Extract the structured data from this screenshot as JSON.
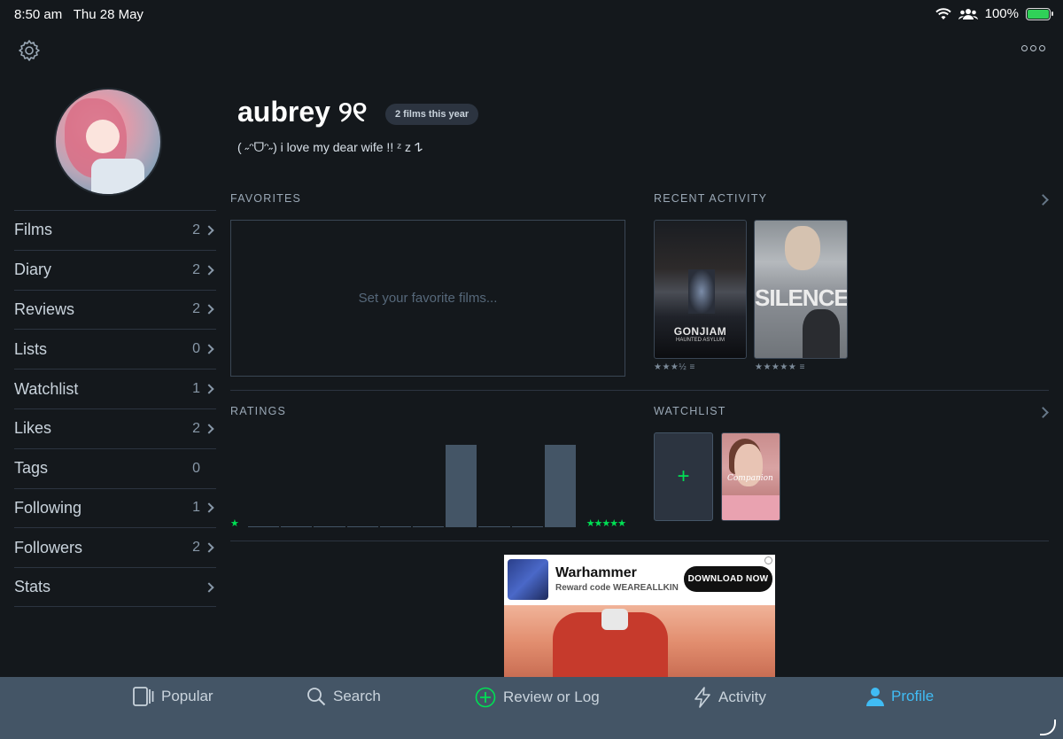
{
  "status_bar": {
    "time": "8:50 am",
    "date": "Thu 28 May",
    "battery": "100%"
  },
  "profile": {
    "username": "aubrey ୨୧",
    "films_badge": "2 films this year",
    "bio": "( ˶ᵔᗜᵔ˶) i love my dear wife !! ᶻ z 𐰁"
  },
  "menu": [
    {
      "label": "Films",
      "count": "2",
      "chevron": true
    },
    {
      "label": "Diary",
      "count": "2",
      "chevron": true
    },
    {
      "label": "Reviews",
      "count": "2",
      "chevron": true
    },
    {
      "label": "Lists",
      "count": "0",
      "chevron": true
    },
    {
      "label": "Watchlist",
      "count": "1",
      "chevron": true
    },
    {
      "label": "Likes",
      "count": "2",
      "chevron": true
    },
    {
      "label": "Tags",
      "count": "0",
      "chevron": false
    },
    {
      "label": "Following",
      "count": "1",
      "chevron": true
    },
    {
      "label": "Followers",
      "count": "2",
      "chevron": true
    },
    {
      "label": "Stats",
      "count": "",
      "chevron": true
    }
  ],
  "favorites": {
    "title": "FAVORITES",
    "placeholder": "Set your favorite films..."
  },
  "recent_activity": {
    "title": "RECENT ACTIVITY",
    "items": [
      {
        "poster_title": "GONJIAM",
        "poster_subtitle": "HAUNTED ASYLUM",
        "meta": "★★★½ ≡"
      },
      {
        "poster_title": "SILENCED",
        "meta": "★★★★★ ≡"
      }
    ]
  },
  "ratings": {
    "title": "RATINGS",
    "min_label": "★",
    "max_label": "★★★★★",
    "chart_data": {
      "type": "bar",
      "categories": [
        "0.5",
        "1",
        "1.5",
        "2",
        "2.5",
        "3",
        "3.5",
        "4",
        "4.5",
        "5"
      ],
      "values": [
        0,
        0,
        0,
        0,
        0,
        0,
        1,
        0,
        0,
        1
      ],
      "ylim": [
        0,
        1
      ]
    }
  },
  "watchlist": {
    "title": "WATCHLIST",
    "add_label": "+",
    "items": [
      {
        "poster_title": "Companion"
      }
    ]
  },
  "ad": {
    "title": "Warhammer",
    "subtitle": "Reward code WEAREALLKIN",
    "button": "DOWNLOAD NOW"
  },
  "tabs": [
    {
      "label": "Popular",
      "icon": "popular-icon",
      "active": false
    },
    {
      "label": "Search",
      "icon": "search-icon",
      "active": false
    },
    {
      "label": "Review or Log",
      "icon": "add-circle-icon",
      "active": false
    },
    {
      "label": "Activity",
      "icon": "lightning-icon",
      "active": false
    },
    {
      "label": "Profile",
      "icon": "person-icon",
      "active": true
    }
  ],
  "colors": {
    "background": "#14181c",
    "accent_green": "#00e054",
    "accent_blue": "#40bcf4",
    "tabbar": "#445566"
  }
}
